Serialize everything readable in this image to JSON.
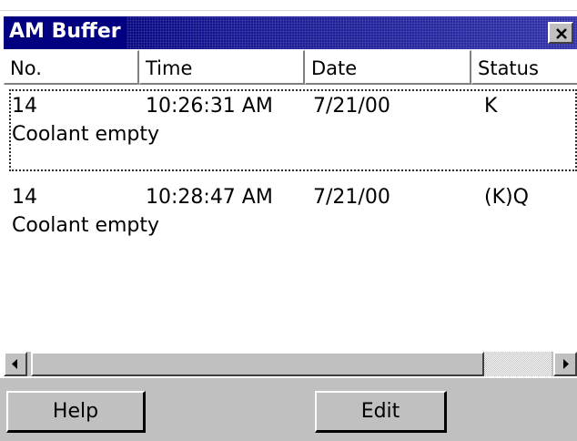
{
  "window": {
    "title": "AM Buffer",
    "title_bar_color": "#000080",
    "close_icon": "close-icon"
  },
  "columns": [
    "No.",
    "Time",
    "Date",
    "Status"
  ],
  "rows": [
    {
      "no": "14",
      "time": "10:26:31 AM",
      "date": "7/21/00",
      "status": "K",
      "description": "Coolant empty",
      "focused": true
    },
    {
      "no": "14",
      "time": "10:28:47 AM",
      "date": "7/21/00",
      "status": "(K)Q",
      "description": "Coolant empty",
      "focused": false
    }
  ],
  "scrollbar": {
    "left_icon": "arrow-left-icon",
    "right_icon": "arrow-right-icon"
  },
  "buttons": {
    "help": "Help",
    "edit": "Edit"
  }
}
